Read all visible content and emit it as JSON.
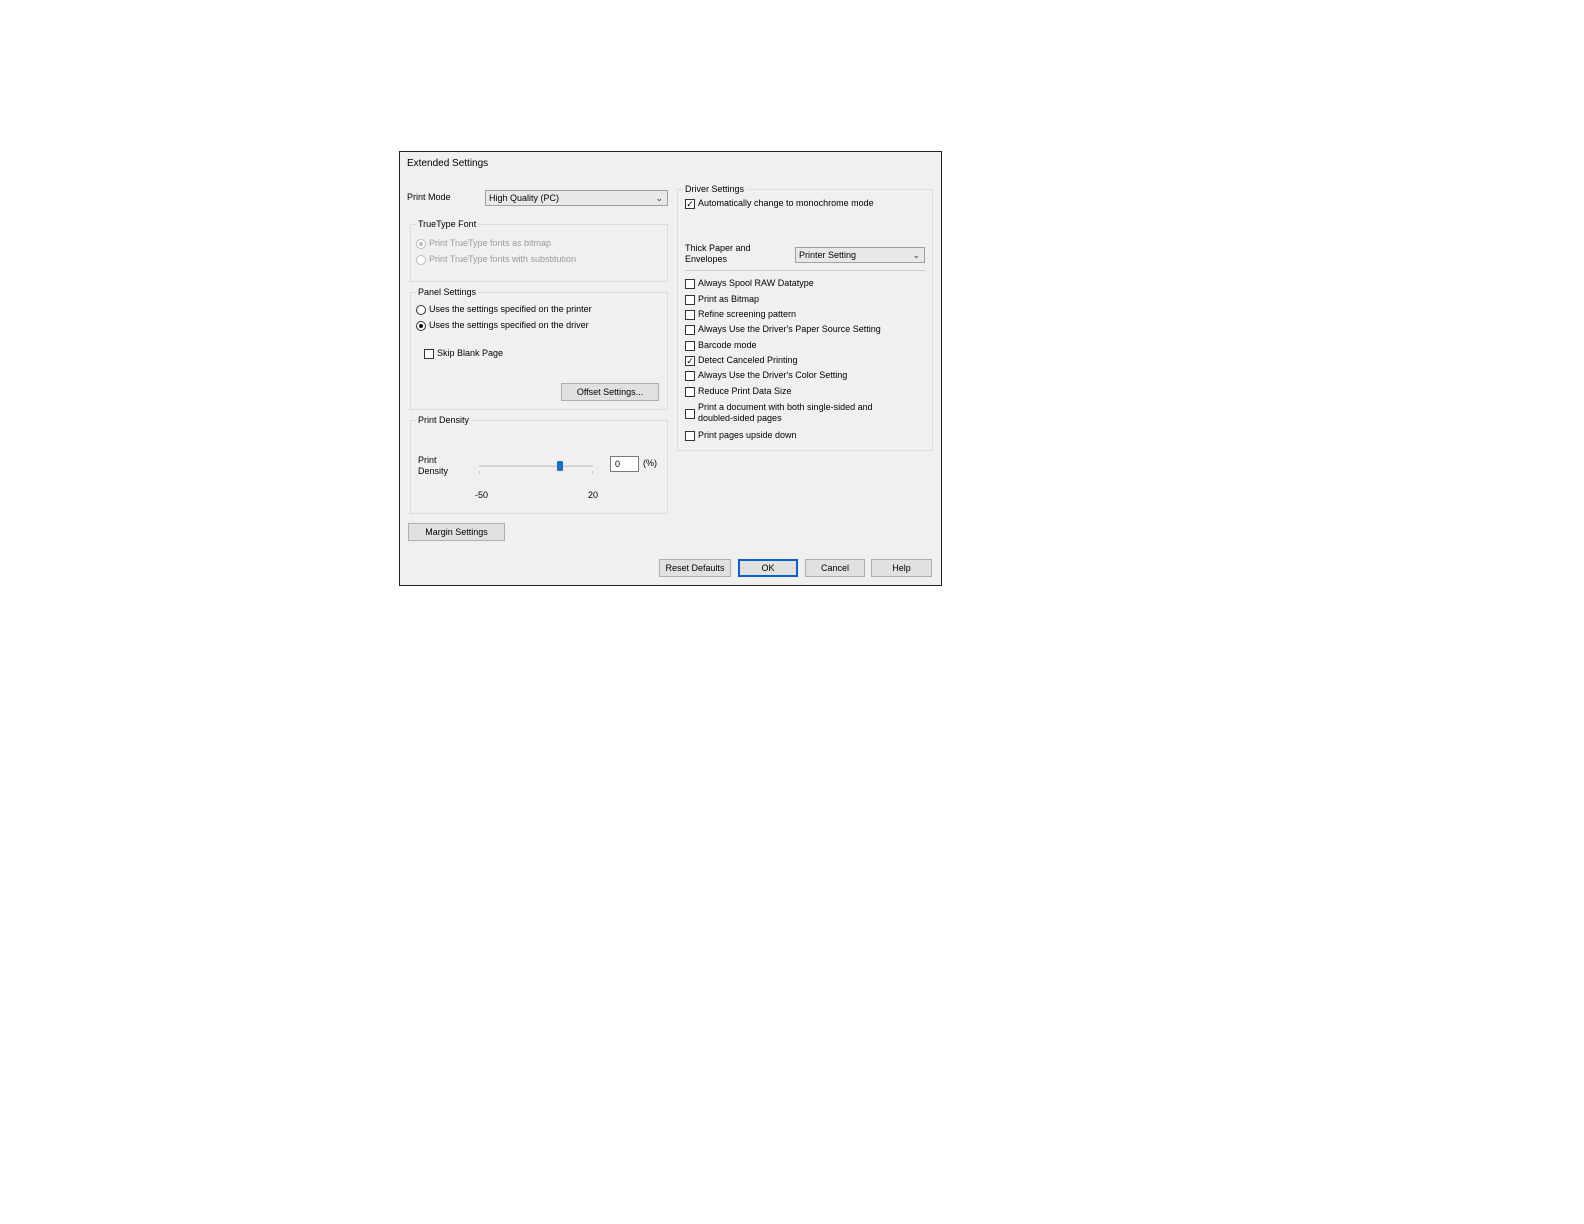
{
  "dialog": {
    "title": "Extended Settings"
  },
  "print_mode": {
    "label": "Print Mode",
    "value": "High Quality (PC)"
  },
  "truetype": {
    "title": "TrueType Font",
    "options": [
      {
        "label": "Print TrueType fonts as bitmap",
        "selected": true,
        "enabled": false
      },
      {
        "label": "Print TrueType fonts with substitution",
        "selected": false,
        "enabled": false
      }
    ]
  },
  "panel": {
    "title": "Panel Settings",
    "options": [
      {
        "label": "Uses the settings specified on the printer",
        "selected": false
      },
      {
        "label": "Uses the settings specified on the driver",
        "selected": true
      }
    ],
    "skip_blank": {
      "label": "Skip Blank Page",
      "checked": false
    },
    "offset_button": "Offset Settings..."
  },
  "density": {
    "title": "Print Density",
    "label": "Print Density",
    "value": "0",
    "unit": "(%)",
    "min_label": "-50",
    "max_label": "20",
    "slider_fraction": 0.7143
  },
  "margin_button": "Margin Settings",
  "driver": {
    "title": "Driver Settings",
    "auto_mono": {
      "label": "Automatically change to monochrome mode",
      "checked": true
    },
    "thick_paper": {
      "label": "Thick Paper and Envelopes",
      "value": "Printer Setting"
    },
    "options": [
      {
        "label": "Always Spool RAW Datatype",
        "checked": false
      },
      {
        "label": "Print as Bitmap",
        "checked": false
      },
      {
        "label": "Refine screening pattern",
        "checked": false
      },
      {
        "label": "Always Use the Driver's Paper Source Setting",
        "checked": false
      },
      {
        "label": "Barcode mode",
        "checked": false
      },
      {
        "label": "Detect Canceled Printing",
        "checked": true
      },
      {
        "label": "Always Use the Driver's Color Setting",
        "checked": false
      },
      {
        "label": "Reduce Print Data Size",
        "checked": false
      },
      {
        "label": "Print a document with both single-sided and doubled-sided pages",
        "checked": false
      },
      {
        "label": "Print pages upside down",
        "checked": false
      }
    ]
  },
  "buttons": {
    "reset": "Reset Defaults",
    "ok": "OK",
    "cancel": "Cancel",
    "help": "Help"
  },
  "icons": {
    "check": "✓",
    "chevron": "⌄"
  }
}
